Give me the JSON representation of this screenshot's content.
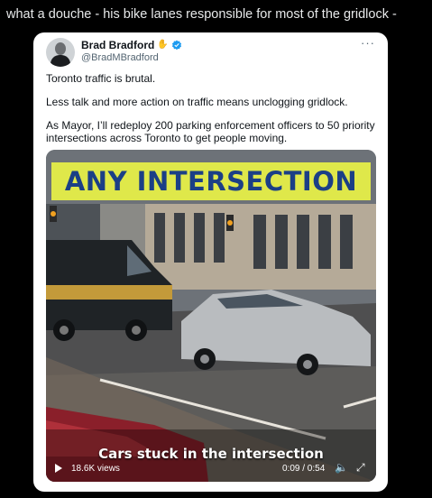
{
  "post": {
    "caption": "what a douche - his bike lanes responsible for most of the gridlock -"
  },
  "tweet": {
    "author": {
      "name": "Brad Bradford",
      "handle": "@BradMBradford",
      "wave_emoji": "✋",
      "verified_color": "#1d9bf0"
    },
    "more": "···",
    "paragraphs": [
      "Toronto traffic is brutal.",
      "Less talk and more action on traffic means unclogging gridlock.",
      "As Mayor, I’ll redeploy 200 parking enforcement officers to 50 priority intersections across Toronto to get people moving."
    ],
    "video": {
      "banner": "ANY INTERSECTION",
      "subtitle": "Cars stuck in the intersection",
      "views": "18.6K views",
      "time": "0:09 / 0:54",
      "banner_bg": "#dfe84a",
      "banner_color": "#1b3f86"
    }
  }
}
